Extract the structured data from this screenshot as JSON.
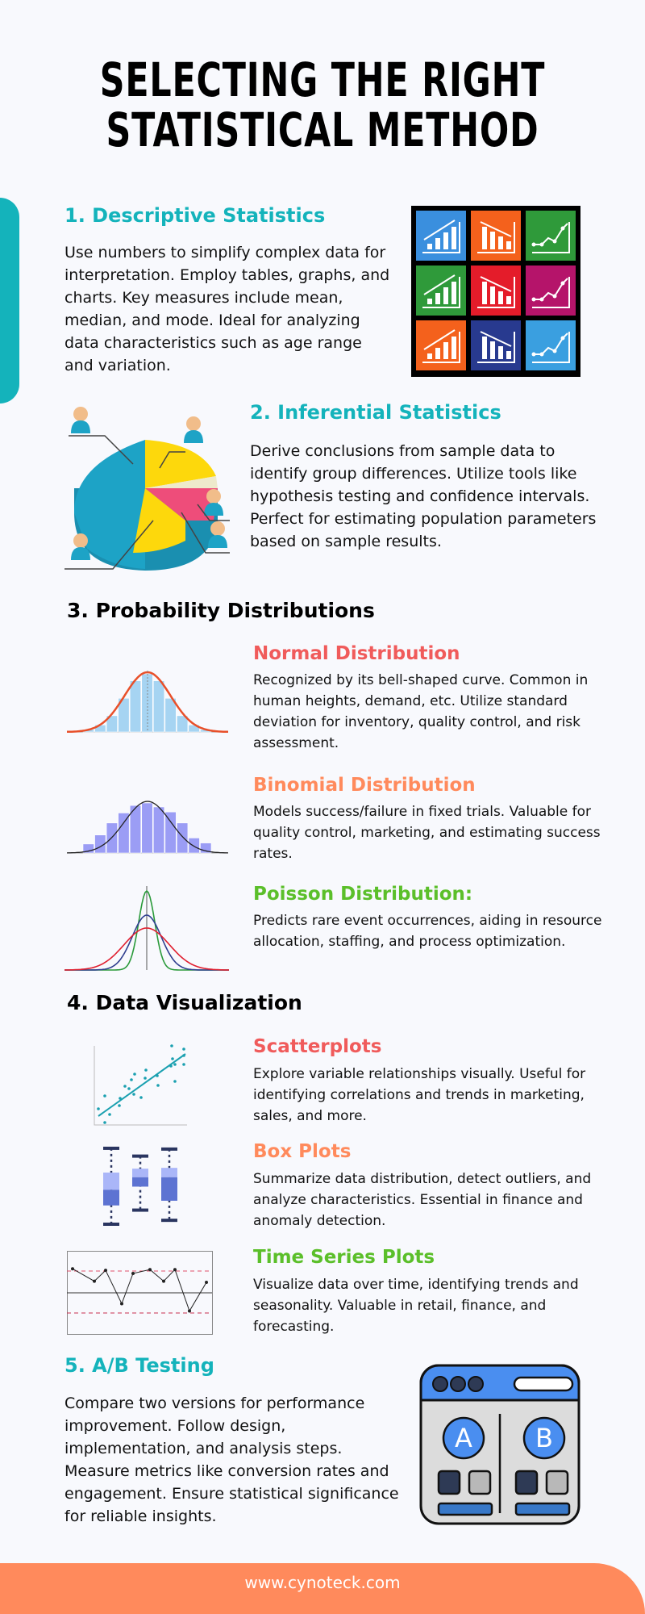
{
  "title": {
    "line1": "SELECTING THE RIGHT",
    "line2": "STATISTICAL METHOD"
  },
  "sections": {
    "descriptive": {
      "heading": "1. Descriptive Statistics",
      "body": "Use numbers to simplify complex data for interpretation. Employ tables, graphs, and charts. Key measures include mean, median, and mode. Ideal for analyzing data characteristics such as age range and variation.",
      "icon_grid_colors": [
        "#3a8fde",
        "#f4611c",
        "#2f9a3a",
        "#2f9a3a",
        "#e41c2a",
        "#b5146a",
        "#f4611c",
        "#283a8f",
        "#3a9fe0"
      ]
    },
    "inferential": {
      "heading": "2. Inferential Statistics",
      "body": "Derive conclusions from sample data to identify group differences. Utilize tools like hypothesis testing and confidence intervals. Perfect for estimating population parameters based on sample results."
    },
    "probability": {
      "heading": "3. Probability Distributions",
      "items": [
        {
          "title": "Normal Distribution",
          "body": "Recognized by its bell-shaped curve. Common in human heights, demand, etc. Utilize standard deviation for inventory, quality control, and risk assessment."
        },
        {
          "title": "Binomial Distribution",
          "body": "Models success/failure in fixed trials. Valuable for quality control, marketing, and estimating success rates."
        },
        {
          "title": "Poisson Distribution:",
          "body": "Predicts rare event occurrences, aiding in resource allocation, staffing, and process optimization."
        }
      ]
    },
    "visualization": {
      "heading": "4. Data Visualization",
      "items": [
        {
          "title": "Scatterplots",
          "body": "Explore variable relationships visually. Useful for identifying correlations and trends in marketing, sales, and more."
        },
        {
          "title": "Box Plots",
          "body": "Summarize data distribution, detect outliers, and analyze characteristics. Essential in finance and anomaly detection."
        },
        {
          "title": "Time Series Plots",
          "body": "Visualize data over time, identifying trends and seasonality. Valuable in retail, finance, and forecasting."
        }
      ]
    },
    "ab_testing": {
      "heading": "5. A/B Testing",
      "body": "Compare two versions for performance improvement. Follow design, implementation, and analysis steps. Measure metrics like conversion rates and engagement. Ensure statistical significance for reliable insights.",
      "variant_a": "A",
      "variant_b": "B"
    }
  },
  "footer": {
    "url": "www.cynoteck.com"
  },
  "colors": {
    "teal": "#14b3bb",
    "coral": "#f05b5b",
    "orange": "#ff8a5c",
    "green": "#5bbf2a",
    "footer": "#ff8a5c"
  },
  "illustrations": {
    "normal_hist": [
      0.04,
      0.12,
      0.28,
      0.58,
      0.88,
      1.0,
      0.88,
      0.58,
      0.28,
      0.12,
      0.04
    ],
    "binomial_hist": [
      0.18,
      0.36,
      0.6,
      0.8,
      0.95,
      1.0,
      0.92,
      0.82,
      0.6,
      0.3,
      0.2
    ],
    "time_series": [
      0.62,
      0.3,
      0.58,
      -0.28,
      0.5,
      0.6,
      0.3,
      0.6,
      -0.47,
      0.27
    ],
    "box_plots": [
      {
        "min": 0.0,
        "q1": 0.24,
        "median": 0.44,
        "q3": 0.66,
        "max": 0.97
      },
      {
        "min": 0.18,
        "q1": 0.48,
        "median": 0.6,
        "q3": 0.71,
        "max": 0.87
      },
      {
        "min": 0.05,
        "q1": 0.3,
        "median": 0.6,
        "q3": 0.72,
        "max": 0.96
      }
    ]
  }
}
